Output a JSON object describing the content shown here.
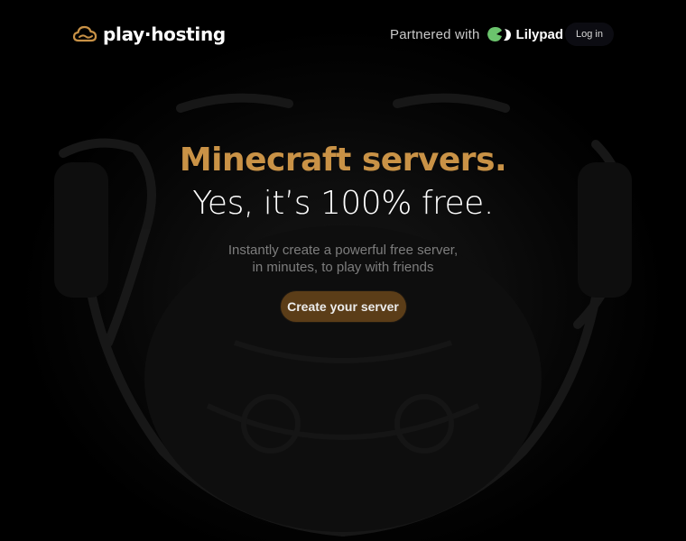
{
  "header": {
    "logo_text": "play·hosting",
    "logo_icon": "cloud-icon",
    "partner_label": "Partnered with",
    "partner_name": "Lilypad",
    "partner_icon": "lilypad-leaf-icon",
    "login_label": "Log in"
  },
  "hero": {
    "headline_primary": "Minecraft servers.",
    "headline_secondary": "Yes, it’s 100% free.",
    "subtitle_line1": "Instantly create a powerful free server,",
    "subtitle_line2": "in minutes, to play with friends",
    "cta_label": "Create your server"
  },
  "colors": {
    "accent": "#c99246",
    "cta_background": "#5b3d18",
    "background": "#000000",
    "partner_green": "#6bc46d"
  }
}
